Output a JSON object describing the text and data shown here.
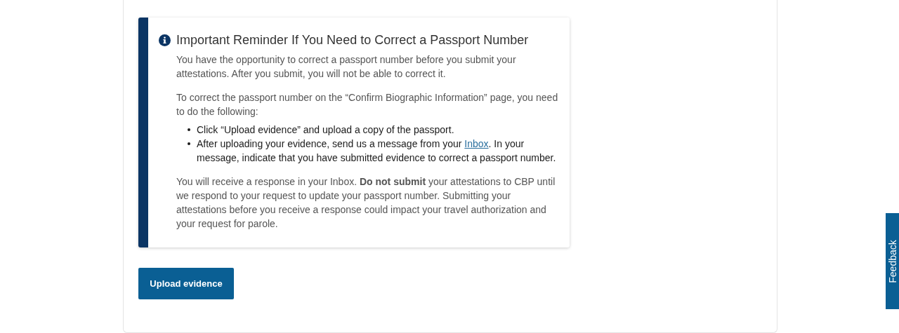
{
  "alert": {
    "title": "Important Reminder If You Need to Correct a Passport Number",
    "paragraphs": [
      "You have the opportunity to correct a passport number before you submit your attestations. After you submit, you will not be able to correct it.",
      "To correct the passport number on the “Confirm Biographic Information” page, you need to do the following:"
    ],
    "bullets": [
      {
        "before": "Click “Upload evidence” and upload a copy of the passport."
      },
      {
        "before": "After uploading your evidence, send us a message from your ",
        "link": "Inbox",
        "after": ". In your message, indicate that you have submitted evidence to correct a passport number."
      }
    ],
    "closing": "You will receive a response in your Inbox. **Do not submit** your attestations to CBP until we respond to your request to update your passport number. Submitting your attestations before you receive a response could impact your travel authorization and your request for parole."
  },
  "button": "Upload evidence",
  "feedback_tab": "Feedback"
}
